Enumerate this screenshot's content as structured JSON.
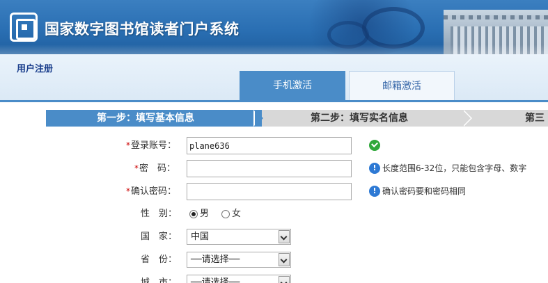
{
  "header": {
    "site_title": "国家数字图书馆读者门户系统"
  },
  "page": {
    "title": "用户注册"
  },
  "tabs": [
    {
      "label": "手机激活",
      "active": true
    },
    {
      "label": "邮箱激活",
      "active": false
    }
  ],
  "steps": [
    {
      "label": "第一步：填写基本信息",
      "active": true
    },
    {
      "label": "第二步：填写实名信息",
      "active": false
    },
    {
      "label": "第三",
      "active": false
    }
  ],
  "form": {
    "required_mark": "*",
    "account": {
      "label": "登录账号：",
      "value": "plane636",
      "status": "ok"
    },
    "password": {
      "label": "密　码：",
      "value": "",
      "hint": "长度范围6-32位，只能包含字母、数字"
    },
    "confirm": {
      "label": "确认密码：",
      "value": "",
      "hint": "确认密码要和密码相同"
    },
    "gender": {
      "label": "性　别：",
      "options": [
        "男",
        "女"
      ],
      "selected": "男"
    },
    "country": {
      "label": "国　家：",
      "value": "中国"
    },
    "province": {
      "label": "省　份：",
      "value": "──请选择──"
    },
    "city": {
      "label": "城　市：",
      "value": "──请选择──"
    }
  },
  "colors": {
    "accent": "#4a8cc8",
    "required": "#cc0000",
    "ok": "#2fa83a",
    "info": "#2d79d4"
  },
  "icons": [
    "library-logo-icon",
    "check-icon",
    "info-icon",
    "dropdown-arrow-icon"
  ]
}
